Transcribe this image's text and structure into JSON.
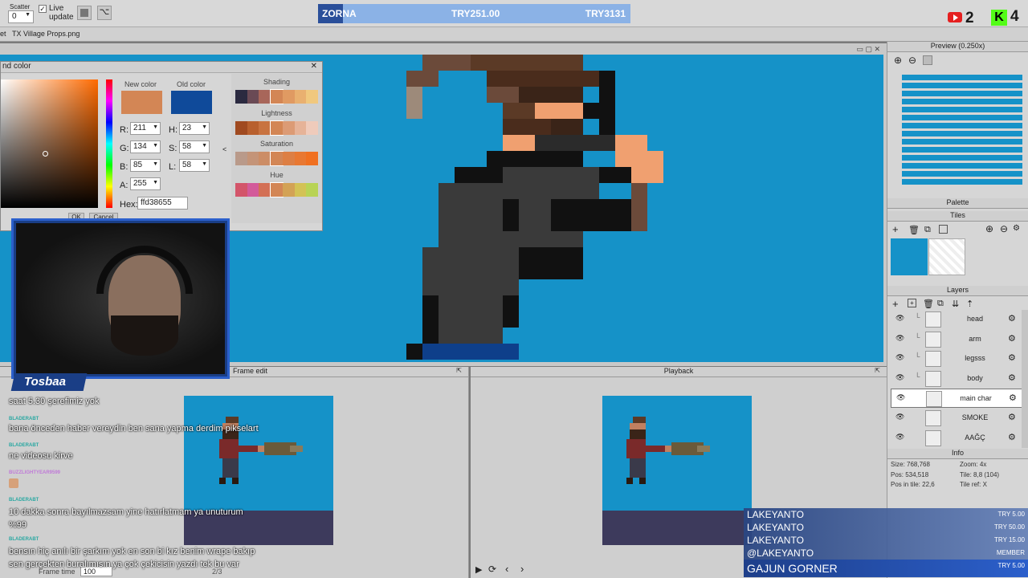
{
  "toolbar": {
    "scatter_label": "Scatter",
    "scatter_value": "0",
    "live_update_label": "Live update"
  },
  "donation_goal": {
    "name": "ZORNA",
    "current": "TRY251.00",
    "target": "TRY3131",
    "progress": 0.08
  },
  "counters": {
    "youtube_count": "2",
    "kick_count": "4"
  },
  "tabs": [
    "et",
    "TX Village Props.png"
  ],
  "color_dialog": {
    "title": "nd color",
    "new_color_label": "New color",
    "old_color_label": "Old color",
    "new_color": "#d38655",
    "old_color": "#0f4a9a",
    "r_label": "R:",
    "r": "211",
    "g_label": "G:",
    "g": "134",
    "b_label": "B:",
    "b": "85",
    "a_label": "A:",
    "a": "255",
    "h_label": "H:",
    "h": "23",
    "s_label": "S:",
    "s": "58",
    "l_label": "L:",
    "l": "58",
    "hex_label": "Hex:",
    "hex": "ffd38655",
    "shading_label": "Shading",
    "lightness_label": "Lightness",
    "saturation_label": "Saturation",
    "hue_label": "Hue",
    "ok_label": "OK",
    "cancel_label": "Cancel"
  },
  "streamer_name": "Tosbaa",
  "chat": [
    {
      "user": "",
      "message": "saat 5.30 şerefimiz yok"
    },
    {
      "user": "BLADERABT",
      "message": "bana önceden haber vereydin ben sana yapma derdim pikselart"
    },
    {
      "user": "BLADERABT",
      "message": "ne videosu kirve"
    },
    {
      "user": "BUZZLIGHTYEAR9599",
      "message": ""
    },
    {
      "user": "BLADERABT",
      "message": "10 dakka sonra bayılmazsam yine hatırlatmam ya unuturum %99"
    },
    {
      "user": "BLADERABT",
      "message": "bensın hiç anılı bir şarkım yok en son bi kız benim wrape bakıp sen gerçekten buralımısın ya çok çekicisin yazdı tek bu var"
    }
  ],
  "frame_edit": {
    "title": "Frame edit",
    "frame_time_label": "Frame time",
    "frame_time": "100",
    "frame_counter": "2/3"
  },
  "playback": {
    "title": "Playback"
  },
  "preview": {
    "title": "Preview (0.250x)"
  },
  "palette": {
    "title": "Palette"
  },
  "tiles": {
    "title": "Tiles"
  },
  "layers": {
    "title": "Layers",
    "items": [
      "head",
      "arm",
      "legsss",
      "body",
      "main char",
      "SMOKE",
      "AAĞÇ"
    ],
    "selected": "main char"
  },
  "info": {
    "title": "Info",
    "size": "Size: 768,768",
    "zoom": "Zoom: 4x",
    "pos": "Pos: 534,518",
    "tile": "Tile: 8,8 (104)",
    "pos_in_tile": "Pos in tile: 22,6",
    "tile_ref": "Tile ref: X"
  },
  "donors": [
    {
      "name": "LAKEYANTO",
      "amount": "TRY 5.00"
    },
    {
      "name": "LAKEYANTO",
      "amount": "TRY 50.00"
    },
    {
      "name": "LAKEYANTO",
      "amount": "TRY 15.00"
    },
    {
      "name": "@LAKEYANTO",
      "amount": "MEMBER"
    },
    {
      "name": "GAJUN GORNER",
      "amount": "TRY 5.00"
    }
  ],
  "colors": {
    "canvas_blue": "#1592c8",
    "dialog_bg": "#d6d6d6",
    "accent": "#2b5fcb"
  }
}
